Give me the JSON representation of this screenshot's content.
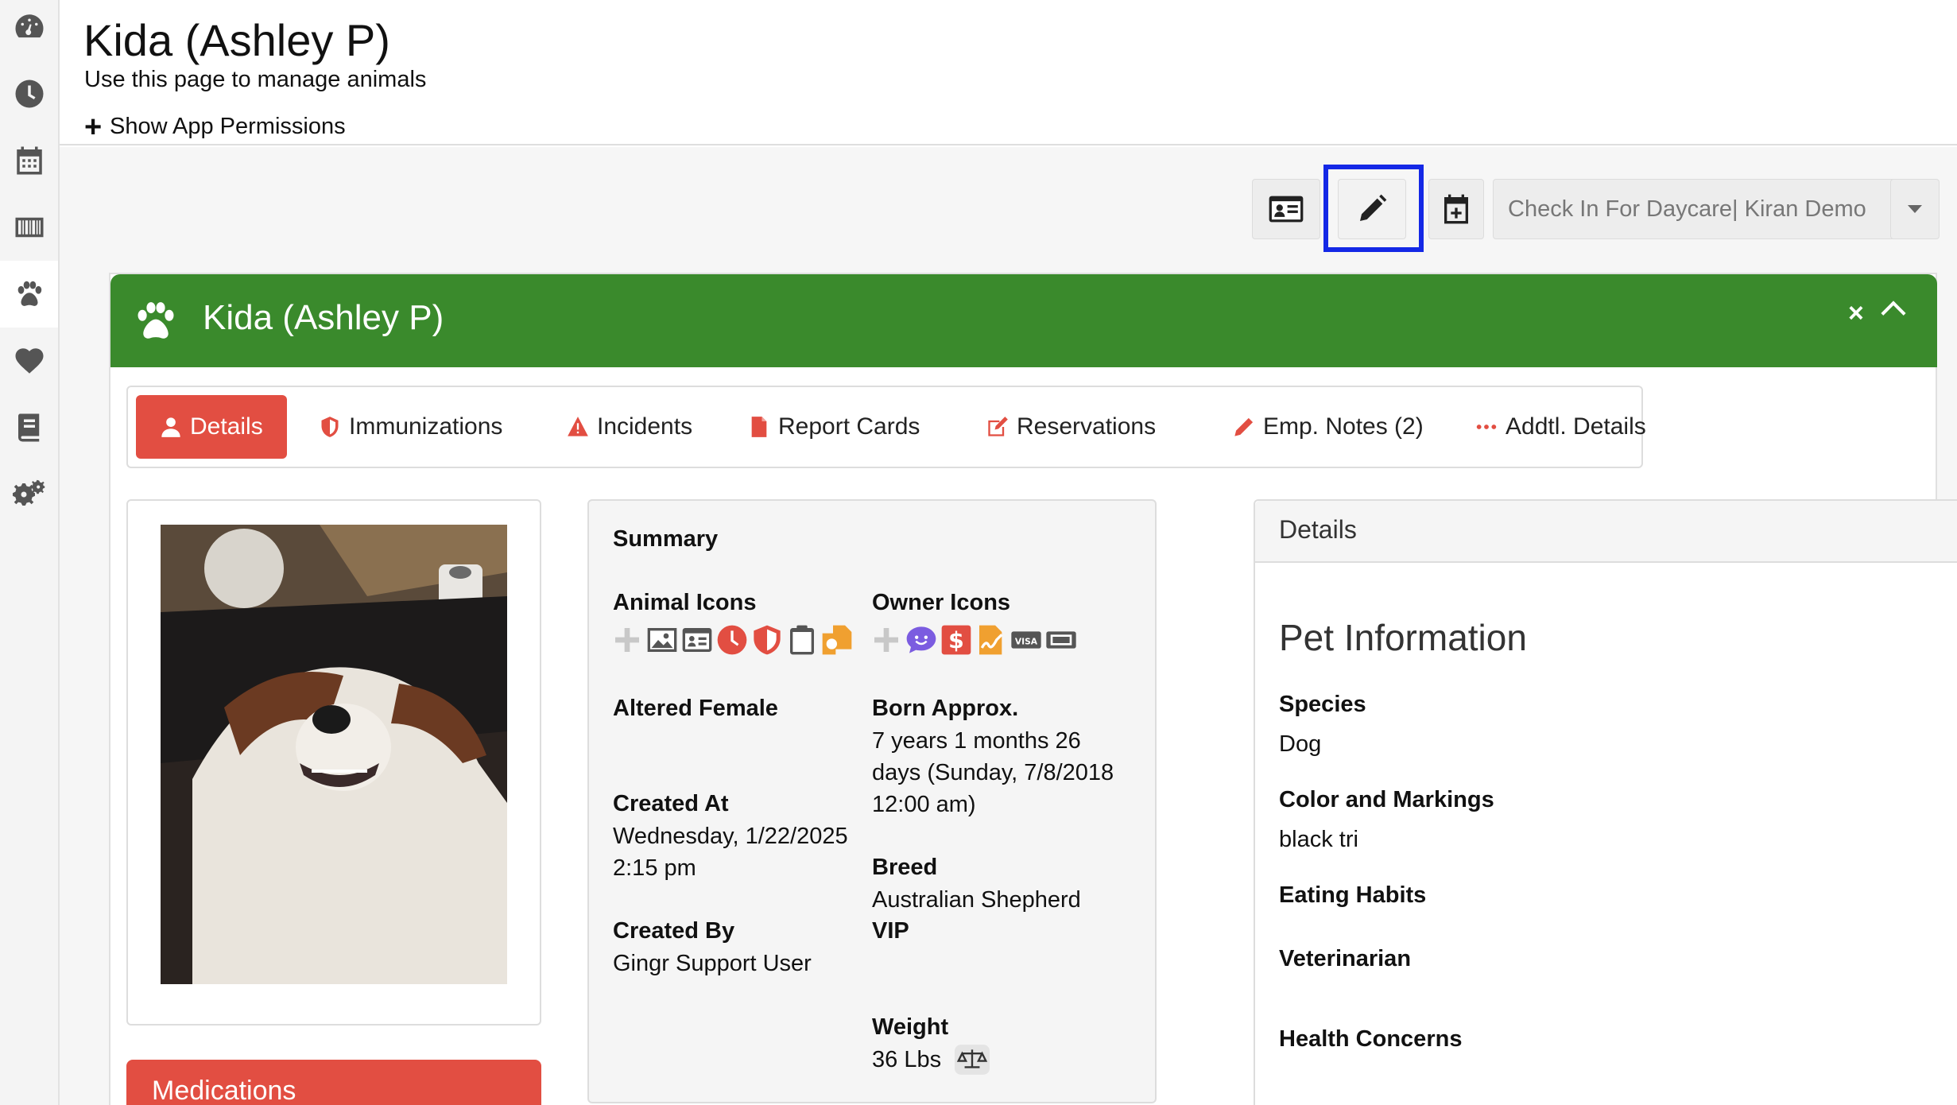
{
  "sidebar": {
    "items": [
      {
        "icon": "dashboard-icon"
      },
      {
        "icon": "clock-icon"
      },
      {
        "icon": "calendar-icon"
      },
      {
        "icon": "barcode-icon"
      },
      {
        "icon": "paw-icon",
        "active": true
      },
      {
        "icon": "heart-icon"
      },
      {
        "icon": "book-icon"
      },
      {
        "icon": "gears-icon"
      }
    ]
  },
  "header": {
    "title": "Kida (Ashley P)",
    "subtitle": "Use this page to manage animals",
    "permissions_link": "Show App Permissions"
  },
  "toolbar": {
    "buttons": [
      "id-card-icon",
      "pencil-icon",
      "calendar-plus-icon"
    ],
    "checkin_label": "Check In For Daycare| Kiran Demo"
  },
  "panel": {
    "title": "Kida (Ashley P)",
    "close_label": "×",
    "header_color": "#3a8a2c"
  },
  "tabs": [
    {
      "label": "Details",
      "icon": "user-icon",
      "active": true
    },
    {
      "label": "Immunizations",
      "icon": "shield-icon"
    },
    {
      "label": "Incidents",
      "icon": "warning-icon"
    },
    {
      "label": "Report Cards",
      "icon": "file-icon"
    },
    {
      "label": "Reservations",
      "icon": "edit-icon"
    },
    {
      "label": "Emp. Notes (2)",
      "icon": "pencil-icon"
    },
    {
      "label": "Addtl. Details",
      "icon": "ellipsis-icon"
    }
  ],
  "summary": {
    "title": "Summary",
    "animal_icons_label": "Animal Icons",
    "owner_icons_label": "Owner Icons",
    "altered": "Altered Female",
    "born_label": "Born Approx.",
    "born_value_1": "7 years 1 months 26",
    "born_value_2": "days (Sunday, 7/8/2018",
    "born_value_3": "12:00 am)",
    "created_at_label": "Created At",
    "created_at_1": "Wednesday, 1/22/2025",
    "created_at_2": "2:15 pm",
    "breed_label": "Breed",
    "breed_value": "Australian Shepherd",
    "vip_label": "VIP",
    "created_by_label": "Created By",
    "created_by_value": "Gingr Support User",
    "weight_label": "Weight",
    "weight_value": "36 Lbs"
  },
  "details": {
    "header": "Details",
    "section_title": "Pet Information",
    "species_label": "Species",
    "species_value": "Dog",
    "color_label": "Color and Markings",
    "color_value": "black tri",
    "eating_label": "Eating Habits",
    "vet_label": "Veterinarian",
    "health_label": "Health Concerns"
  },
  "medications": {
    "title": "Medications"
  },
  "colors": {
    "accent_red": "#e24e42",
    "accent_green": "#3a8a2c",
    "highlight_blue": "#1428e6"
  }
}
